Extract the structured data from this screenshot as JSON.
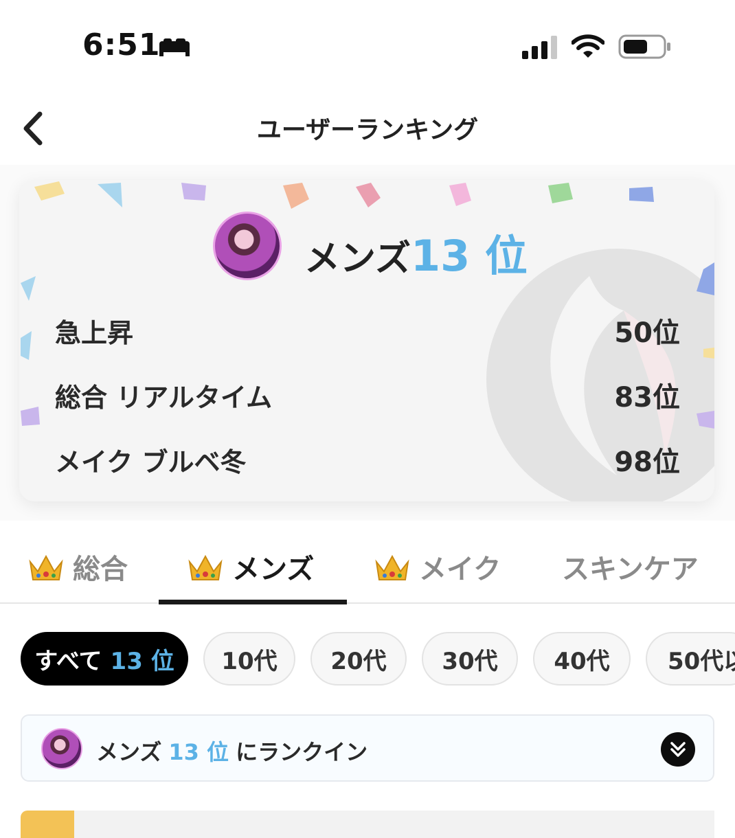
{
  "status_bar": {
    "time": "6:51"
  },
  "header": {
    "title": "ユーザーランキング"
  },
  "summary": {
    "category": "メンズ",
    "rank": "13 位",
    "rows": [
      {
        "label": "急上昇",
        "value": "50位"
      },
      {
        "label": "総合 リアルタイム",
        "value": "83位"
      },
      {
        "label": "メイク ブルベ冬",
        "value": "98位"
      }
    ]
  },
  "tabs": [
    {
      "label": "総合",
      "crown": true,
      "active": false
    },
    {
      "label": "メンズ",
      "crown": true,
      "active": true
    },
    {
      "label": "メイク",
      "crown": true,
      "active": false
    },
    {
      "label": "スキンケア",
      "crown": false,
      "active": false
    }
  ],
  "chips": [
    {
      "label": "すべて",
      "rank": "13 位",
      "active": true
    },
    {
      "label": "10代"
    },
    {
      "label": "20代"
    },
    {
      "label": "30代"
    },
    {
      "label": "40代"
    },
    {
      "label": "50代以"
    }
  ],
  "banner": {
    "category": "メンズ",
    "rank": "13 位",
    "suffix": "にランクイン"
  },
  "colors": {
    "accent_blue": "#5cb2e6",
    "active_chip": "#000000",
    "crown_gold": "#f0b429"
  },
  "icons": [
    "bed-icon",
    "signal-icon",
    "wifi-icon",
    "battery-icon",
    "back-chevron-icon",
    "crown-icon",
    "double-chevron-down-icon"
  ]
}
